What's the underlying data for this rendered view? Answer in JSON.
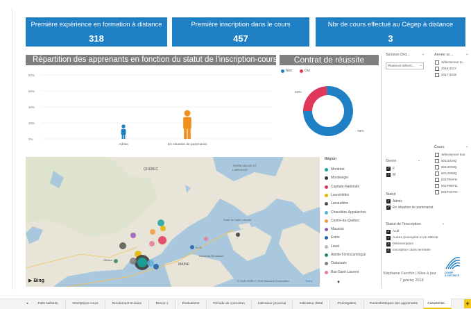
{
  "kpis": [
    {
      "title": "Première expérience en formation à distance",
      "value": "318"
    },
    {
      "title": "Première inscription dans le cours",
      "value": "457"
    },
    {
      "title": "Nbr de cours effectué au Cégep à distance",
      "value": "3"
    }
  ],
  "bar_section": {
    "title": "Répartition des apprenants en fonction du statut de l'inscription-cours"
  },
  "chart_data": [
    {
      "type": "bar",
      "title": "Répartition des apprenants en fonction du statut de l'inscription-cours",
      "categories": [
        "Admis",
        "En situation de partenariat"
      ],
      "values": [
        18,
        36
      ],
      "yticks": [
        "80%",
        "60%",
        "40%",
        "20%",
        "0%"
      ],
      "ylim": [
        0,
        80
      ],
      "colors": [
        "#1f7fc5",
        "#f0901f"
      ]
    },
    {
      "type": "pie",
      "title": "Contrat de réussite",
      "legend": [
        "Non",
        "Oui"
      ],
      "values": [
        24,
        76
      ],
      "labels": [
        "24%",
        "76%"
      ],
      "colors": [
        "#e0385a",
        "#1f7fc5"
      ]
    }
  ],
  "donut_section": {
    "title": "Contrat de réussite",
    "legend_non": "Non",
    "legend_oui": "Oui"
  },
  "map": {
    "labels": {
      "quebec": "QUÉBEC",
      "terre_neuve": "TERRE-NEUVE ET LABRADOR",
      "golfe": "Golfe du Saint-Laurent",
      "nouveau": "Nouveau-Brunswick",
      "maine": "MAINE",
      "nb": "N.-B.",
      "ottawa": "Ottawa",
      "bing": "Bing",
      "copyright": "© 2018 HERE © 2018 Microsoft Corporation",
      "terms": "Terms"
    },
    "regions_title": "Région",
    "regions": [
      {
        "name": "Montréal",
        "color": "#1aa5a0"
      },
      {
        "name": "Montérégie",
        "color": "#333333"
      },
      {
        "name": "Capitale-Nationale",
        "color": "#e0385a"
      },
      {
        "name": "Laurentides",
        "color": "#e8b400"
      },
      {
        "name": "Lanaudière",
        "color": "#555555"
      },
      {
        "name": "Chaudière-Appalaches",
        "color": "#5fb0d8"
      },
      {
        "name": "Centre-du-Québec",
        "color": "#f29b3a"
      },
      {
        "name": "Mauricie",
        "color": "#9b59b6"
      },
      {
        "name": "Estrie",
        "color": "#1f5fa5"
      },
      {
        "name": "Laval",
        "color": "#bbbbbb"
      },
      {
        "name": "Abitibi-Témiscamingue",
        "color": "#2e8b57"
      },
      {
        "name": "Outaouais",
        "color": "#7f7f7f"
      },
      {
        "name": "Bas-Saint-Laurent",
        "color": "#e87a9a"
      }
    ]
  },
  "filters": {
    "session": {
      "label": "Session Ord...",
      "value": "Plusieurs sélecti..."
    },
    "annee": {
      "label": "Année sc...",
      "options": [
        {
          "label": "Sélectionner to...",
          "checked": false
        },
        {
          "label": "2016-2017",
          "checked": false
        },
        {
          "label": "2017-2018",
          "checked": false
        }
      ]
    },
    "cours": {
      "label": "Cours",
      "options": [
        {
          "label": "Sélectionner tout",
          "checked": false
        },
        {
          "label": "601101MQ",
          "checked": false
        },
        {
          "label": "601102MQ",
          "checked": false
        },
        {
          "label": "601103MQ",
          "checked": false
        },
        {
          "label": "601PRAFD",
          "checked": false
        },
        {
          "label": "601PREFD",
          "checked": false
        },
        {
          "label": "601PUCFD",
          "checked": false
        }
      ]
    },
    "genre": {
      "label": "Genre",
      "options": [
        {
          "label": "F",
          "checked": true
        },
        {
          "label": "M",
          "checked": true
        }
      ]
    },
    "statut": {
      "label": "Statut",
      "options": [
        {
          "label": "Admis",
          "checked": true
        },
        {
          "label": "En situation de partenariat",
          "checked": true
        }
      ]
    },
    "statut_inscription": {
      "label": "Statut de l'inscription",
      "options": [
        {
          "label": "Actif",
          "checked": true
        },
        {
          "label": "Autres (exemptiot et en attente",
          "checked": true
        },
        {
          "label": "Désinscription",
          "checked": true
        },
        {
          "label": "Inscription cours terminée",
          "checked": true
        }
      ]
    }
  },
  "footer_note": {
    "line1": "Stéphanie Facchin | Mise à jour",
    "line2": "7 janvier 2018"
  },
  "logo": {
    "line1": "CÉGEP",
    "line2": "À DISTANCE"
  },
  "tabs": [
    "Faits saillants",
    "Inscriptions cours",
    "Rendement scolaire",
    "Devoir 1",
    "Évaluations",
    "Période de correction",
    "Indicateur proximal",
    "Indicateur distal",
    "Prolongation",
    "Caractéristiques des apprenants",
    "Caractéristi..."
  ]
}
